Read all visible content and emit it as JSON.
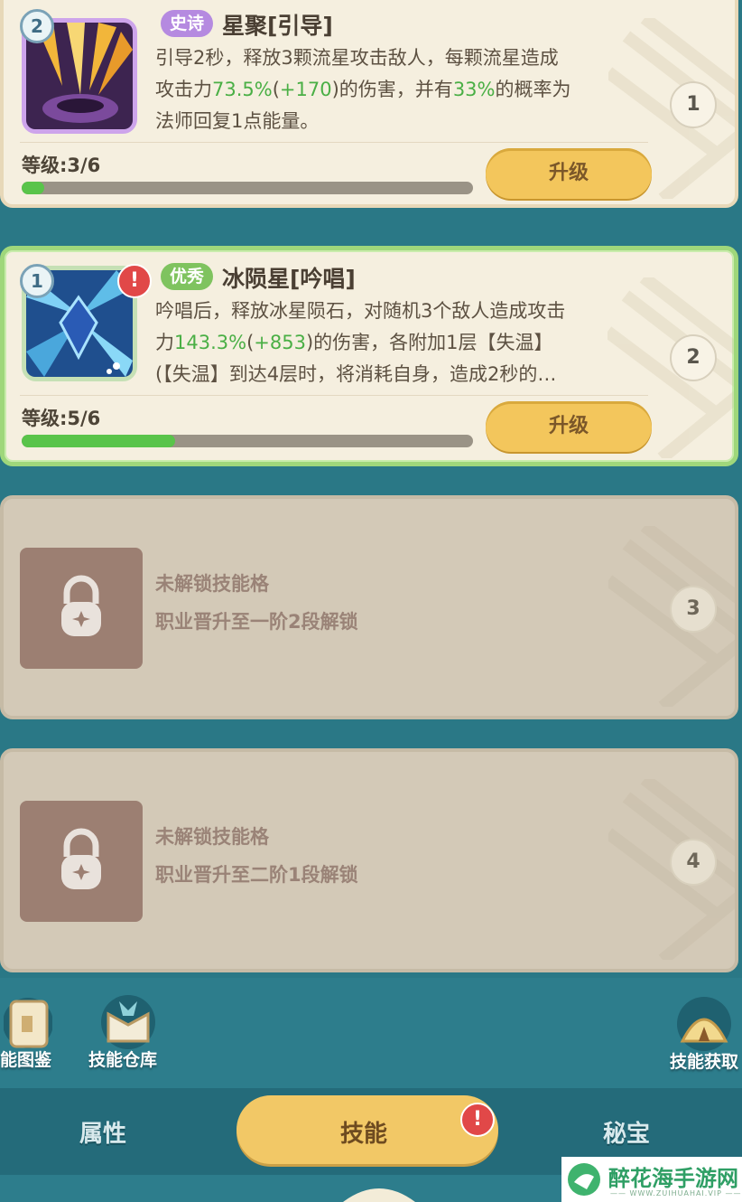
{
  "colors": {
    "accent_green": "#4aaf45",
    "button_yellow": "#f3c65c",
    "card_bg": "#f5efdf",
    "locked_bg": "#d3c9b7",
    "teal_bg": "#2a7886"
  },
  "slots": [
    {
      "slot_number": "1",
      "icon_badge": "2",
      "icon": "meteor-skill-icon",
      "rarity": "史诗",
      "name": "星聚[引导]",
      "desc_line1": "引导2秒，释放3颗流星攻击敌人，每颗流星造成",
      "desc_line2_pre": "攻击力",
      "desc_line2_hl1": "73.5%",
      "desc_line2_mid": "(",
      "desc_line2_hl2": "+170",
      "desc_line2_mid2": ")的伤害，并有",
      "desc_line2_hl3": "33%",
      "desc_line2_post": "的概率为",
      "desc_line3": "法师回复1点能量。",
      "level_text": "等级:3/6",
      "level_progress": 0.05,
      "button": "升级"
    },
    {
      "slot_number": "2",
      "icon_badge": "1",
      "icon": "ice-meteor-skill-icon",
      "alert": "!",
      "rarity": "优秀",
      "name": "冰陨星[吟唱]",
      "desc_line1": "吟唱后，释放冰星陨石，对随机3个敌人造成攻击",
      "desc_line2_pre": "力",
      "desc_line2_hl1": "143.3%",
      "desc_line2_mid": "(",
      "desc_line2_hl2": "+853",
      "desc_line2_post": ")的伤害，各附加1层【失温】",
      "desc_line3": "(【失温】到达4层时，将消耗自身，造成2秒的…",
      "level_text": "等级:5/6",
      "level_progress": 0.34,
      "button": "升级"
    },
    {
      "slot_number": "3",
      "locked_title": "未解锁技能格",
      "locked_condition": "职业晋升至一阶2段解锁"
    },
    {
      "slot_number": "4",
      "locked_title": "未解锁技能格",
      "locked_condition": "职业晋升至二阶1段解锁"
    }
  ],
  "shortcuts": {
    "encyclopedia": "能图鉴",
    "warehouse": "技能仓库",
    "acquire": "技能获取"
  },
  "tabs": {
    "attributes": "属性",
    "skills": "技能",
    "skills_alert": "!",
    "treasure": "秘宝"
  },
  "watermark": {
    "title": "醉花海手游网",
    "subtitle": "—— WWW.ZUIHUAHAI.VIP ——"
  }
}
